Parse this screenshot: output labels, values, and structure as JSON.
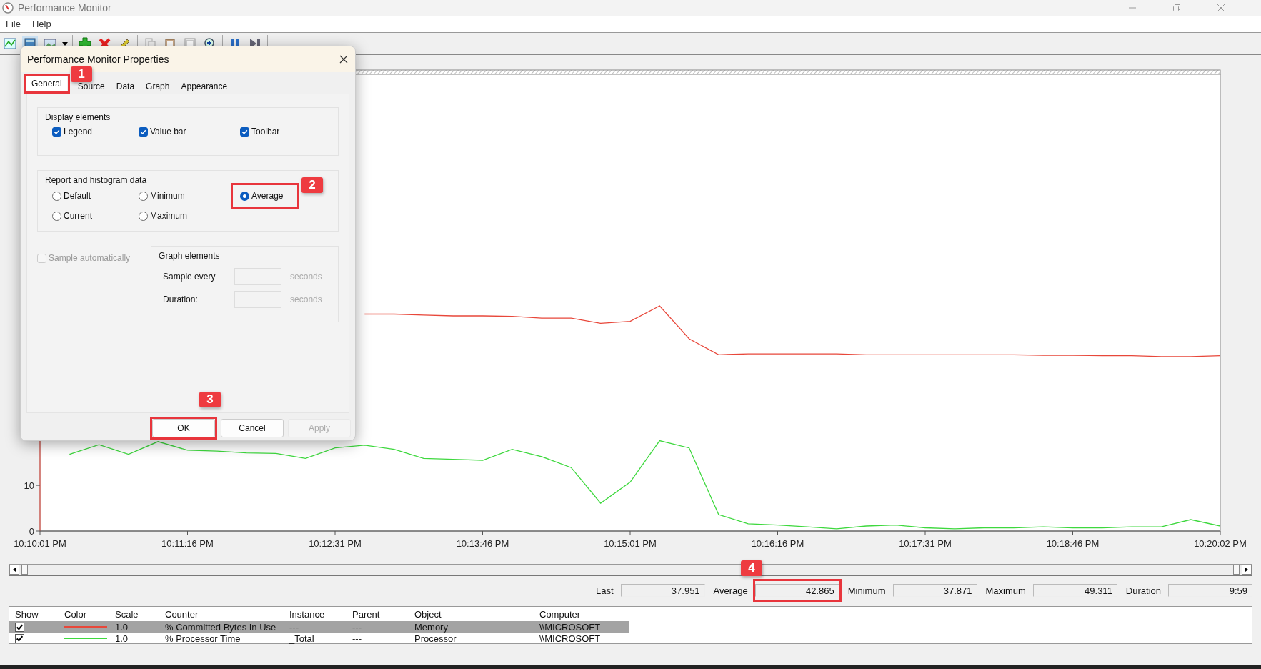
{
  "window": {
    "title": "Performance Monitor"
  },
  "menu": [
    "File",
    "Help"
  ],
  "chart": {
    "chart_data": {
      "type": "line",
      "ylim": [
        0,
        100
      ],
      "yticks": [
        0,
        10
      ],
      "categories": [
        "10:10:01 PM",
        null,
        null,
        null,
        null,
        "10:11:16 PM",
        null,
        null,
        null,
        null,
        "10:12:31 PM",
        null,
        null,
        null,
        null,
        "10:13:46 PM",
        null,
        null,
        null,
        null,
        "10:15:01 PM",
        null,
        null,
        null,
        null,
        "10:16:16 PM",
        null,
        null,
        null,
        null,
        "10:17:31 PM",
        null,
        null,
        null,
        null,
        "10:18:46 PM",
        null,
        null,
        null,
        null,
        "10:20:02 PM"
      ],
      "series": [
        {
          "name": "% Committed Bytes In Use",
          "color": "#e8473a",
          "values": [
            null,
            null,
            null,
            null,
            null,
            null,
            null,
            null,
            null,
            null,
            null,
            47.5,
            47.5,
            47.3,
            47.1,
            47.1,
            47.0,
            46.6,
            46.6,
            45.5,
            45.9,
            49.3,
            42.1,
            38.6,
            38.8,
            38.8,
            38.8,
            38.8,
            38.6,
            38.6,
            38.6,
            38.6,
            38.6,
            38.6,
            38.5,
            38.5,
            38.4,
            38.4,
            38.2,
            38.2,
            38.4
          ]
        },
        {
          "name": "% Processor Time",
          "color": "#3ed83e",
          "values": [
            null,
            16.8,
            18.9,
            16.8,
            19.6,
            17.7,
            17.5,
            17.1,
            17.0,
            15.9,
            18.2,
            18.8,
            17.9,
            15.9,
            15.7,
            15.5,
            17.9,
            16.3,
            13.9,
            6.1,
            10.7,
            19.8,
            18.2,
            3.6,
            1.6,
            1.3,
            0.9,
            0.5,
            1.1,
            1.3,
            0.7,
            0.5,
            0.7,
            0.7,
            0.9,
            0.7,
            0.7,
            0.9,
            0.9,
            2.5,
            1.1
          ]
        }
      ]
    }
  },
  "value_bar": [
    {
      "label": "Last",
      "value": "37.951"
    },
    {
      "label": "Average",
      "value": "42.865"
    },
    {
      "label": "Minimum",
      "value": "37.871"
    },
    {
      "label": "Maximum",
      "value": "49.311"
    },
    {
      "label": "Duration",
      "value": "9:59"
    }
  ],
  "legend": {
    "columns": [
      "Show",
      "Color",
      "Scale",
      "Counter",
      "Instance",
      "Parent",
      "Object",
      "Computer"
    ],
    "rows": [
      {
        "show": true,
        "selected": true,
        "scale": "1.0",
        "instance": "---",
        "parent": "---",
        "object": "Memory",
        "computer": "\\\\MICROSOFT"
      },
      {
        "show": true,
        "selected": false,
        "scale": "1.0",
        "instance": "_Total",
        "parent": "---",
        "object": "Processor",
        "computer": "\\\\MICROSOFT"
      }
    ]
  },
  "dialog": {
    "title": "Performance Monitor Properties",
    "tabs": [
      {
        "label": "General",
        "selected": true
      },
      {
        "label": "Source",
        "selected": false
      },
      {
        "label": "Data",
        "selected": false
      },
      {
        "label": "Graph",
        "selected": false
      },
      {
        "label": "Appearance",
        "selected": false
      }
    ],
    "display_elements": {
      "title": "Display elements",
      "items": [
        {
          "label": "Legend",
          "checked": true
        },
        {
          "label": "Value bar",
          "checked": true
        },
        {
          "label": "Toolbar",
          "checked": true
        }
      ]
    },
    "report_data": {
      "title": "Report and histogram data",
      "options": [
        {
          "label": "Default",
          "selected": false
        },
        {
          "label": "Minimum",
          "selected": false
        },
        {
          "label": "Average",
          "selected": true
        },
        {
          "label": "Current",
          "selected": false
        },
        {
          "label": "Maximum",
          "selected": false
        }
      ]
    },
    "sample_automatically": {
      "label": "Sample automatically",
      "checked": false,
      "disabled": true
    },
    "graph_elements": {
      "title": "Graph elements",
      "fields": [
        {
          "label": "Sample every",
          "unit": "seconds"
        },
        {
          "label": "Duration:",
          "unit": "seconds"
        }
      ]
    },
    "buttons": [
      {
        "label": "OK",
        "disabled": false
      },
      {
        "label": "Cancel",
        "disabled": false
      },
      {
        "label": "Apply",
        "disabled": true
      }
    ]
  },
  "callouts": [
    {
      "number": "1"
    },
    {
      "number": "2"
    },
    {
      "number": "3"
    },
    {
      "number": "4"
    }
  ]
}
